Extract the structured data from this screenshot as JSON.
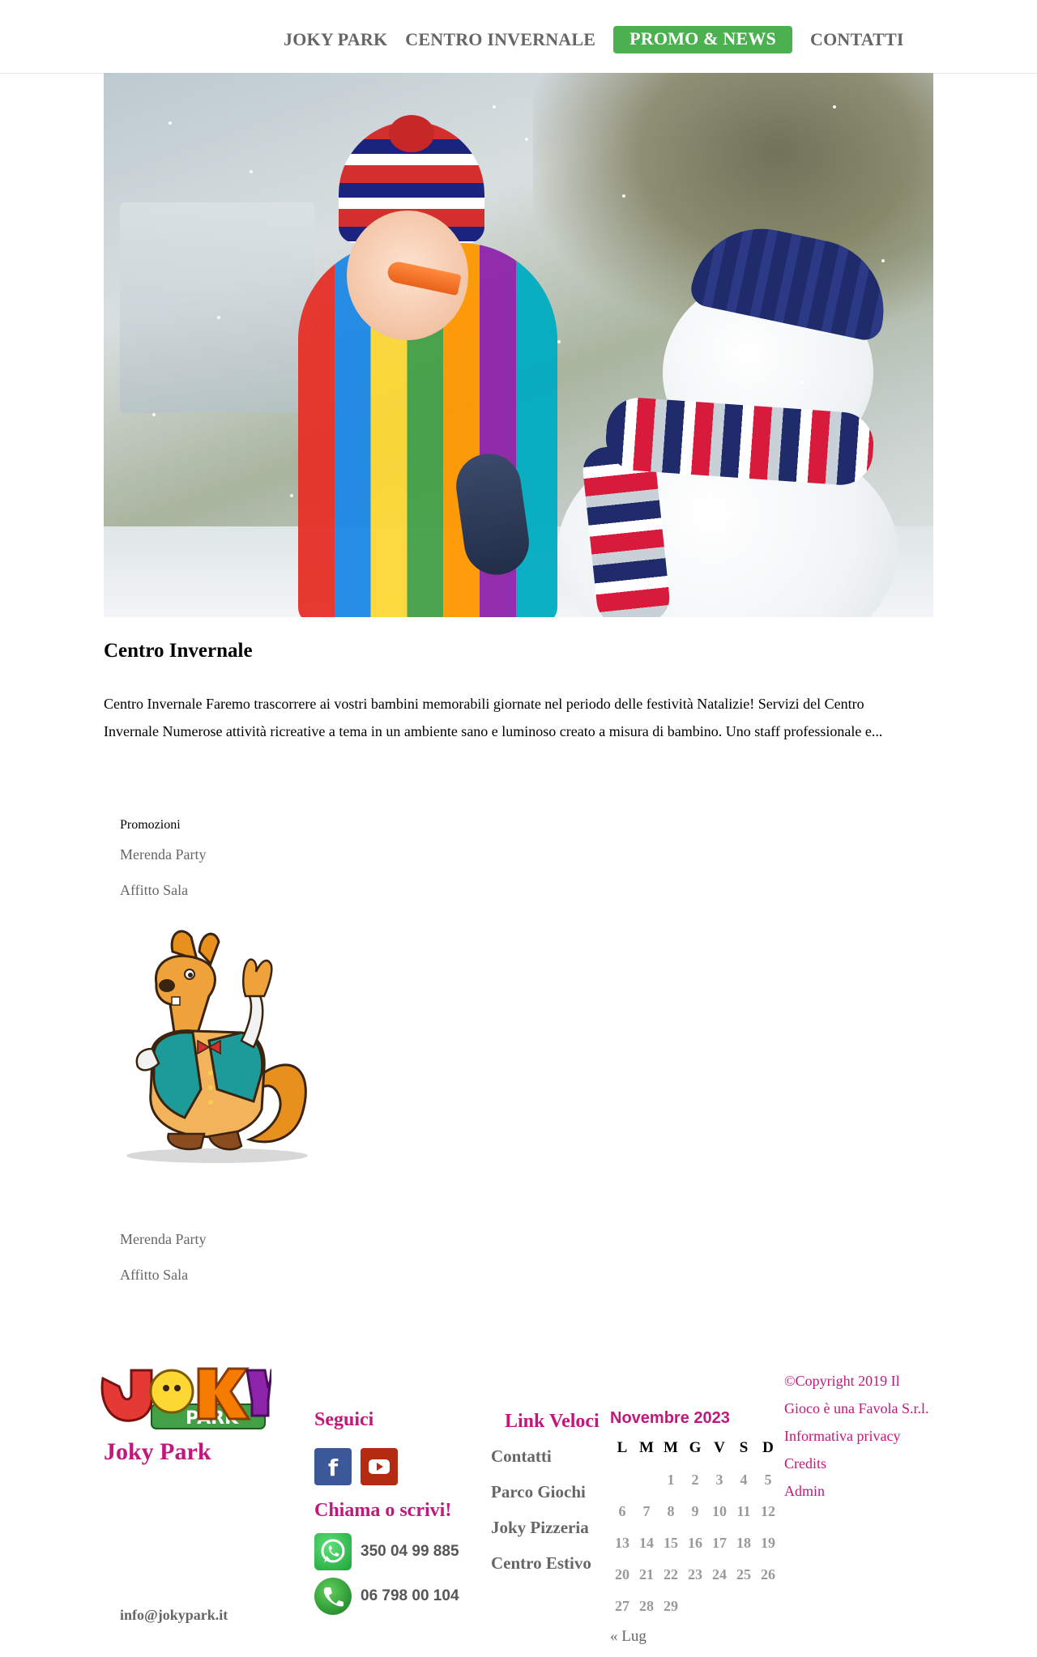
{
  "nav": {
    "items": [
      {
        "label": "JOKY PARK",
        "active": false
      },
      {
        "label": "CENTRO INVERNALE",
        "active": false
      },
      {
        "label": "PROMO & NEWS",
        "active": true
      },
      {
        "label": "CONTATTI",
        "active": false
      }
    ],
    "active_color": "#4caf50"
  },
  "article": {
    "title": "Centro Invernale",
    "excerpt": "Centro Invernale Faremo trascorrere ai vostri bambini memorabili giornate nel periodo delle festività Natalizie! Servizi del Centro Invernale Numerose attività ricreative a tema in un ambiente sano e luminoso creato a misura di bambino. Uno staff professionale e..."
  },
  "promotions": {
    "title": "Promozioni",
    "links": [
      "Merenda Party",
      "Affitto Sala"
    ],
    "links_repeat": [
      "Merenda Party",
      "Affitto Sala"
    ]
  },
  "footer": {
    "brand": "Joky Park",
    "email": "info@jokypark.it",
    "follow_heading": "Seguici",
    "call_heading": "Chiama o scrivi!",
    "whatsapp": "350 04 99 885",
    "phone": "06 798 00 104",
    "quick_heading": "Link Veloci",
    "quick_links": [
      "Contatti",
      "Parco Giochi",
      "Joky Pizzeria",
      "Centro Estivo"
    ],
    "calendar": {
      "caption": "Novembre 2023",
      "weekdays": [
        "L",
        "M",
        "M",
        "G",
        "V",
        "S",
        "D"
      ],
      "weeks": [
        [
          "",
          "",
          "1",
          "2",
          "3",
          "4",
          "5"
        ],
        [
          "6",
          "7",
          "8",
          "9",
          "10",
          "11",
          "12"
        ],
        [
          "13",
          "14",
          "15",
          "16",
          "17",
          "18",
          "19"
        ],
        [
          "20",
          "21",
          "22",
          "23",
          "24",
          "25",
          "26"
        ],
        [
          "27",
          "28",
          "29",
          "",
          "",
          "",
          ""
        ]
      ],
      "prev": "« Lug"
    },
    "legal": {
      "copyright": "©Copyright 2019 Il Gioco è una Favola S.r.l.",
      "privacy": "Informativa privacy",
      "credits": "Credits",
      "admin": "Admin"
    },
    "accent_color": "#c2177b"
  },
  "icons": {
    "facebook": "facebook-icon",
    "youtube": "youtube-icon",
    "whatsapp": "whatsapp-icon",
    "phone": "phone-icon"
  }
}
